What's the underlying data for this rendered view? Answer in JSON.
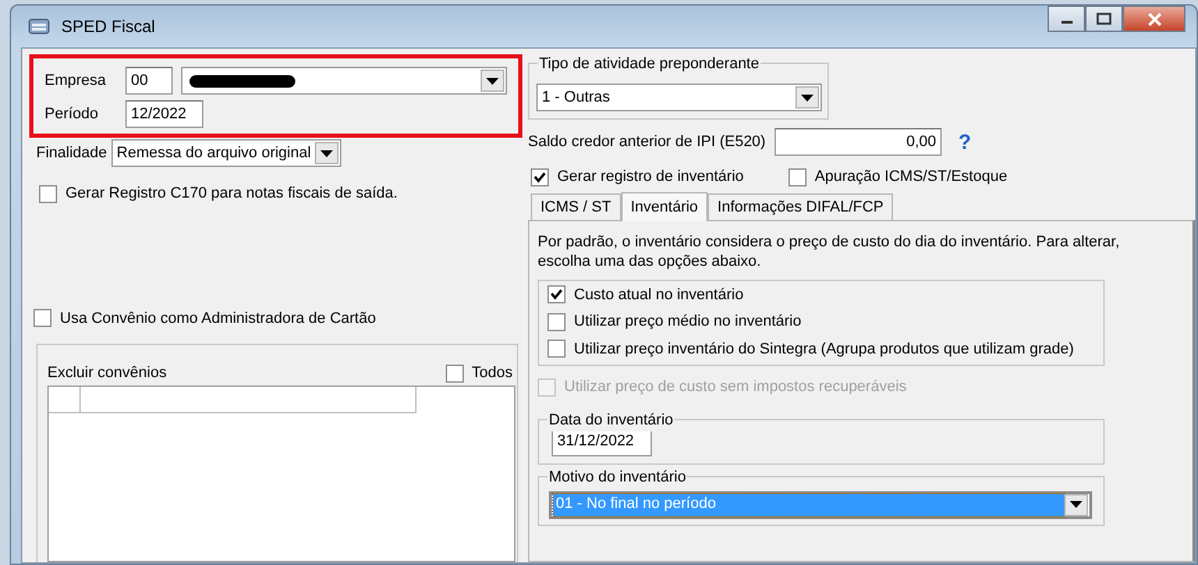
{
  "window": {
    "title": "SPED Fiscal"
  },
  "empresa": {
    "label": "Empresa",
    "code": "00"
  },
  "periodo": {
    "label": "Período",
    "value": "12/2022"
  },
  "finalidade": {
    "label": "Finalidade",
    "value": "Remessa do arquivo original"
  },
  "left_checks": [
    {
      "label": "Gerar Registro C170 para notas fiscais de saída.",
      "checked": false
    },
    {
      "label": "Usa Convênio como Administradora de Cartão",
      "checked": false
    }
  ],
  "excluir_convenios": {
    "label": "Excluir convênios",
    "todos": {
      "label": "Todos",
      "checked": false
    }
  },
  "tipo_atividade": {
    "legend": "Tipo de atividade preponderante",
    "value": "1 - Outras"
  },
  "saldo_ipi": {
    "label": "Saldo credor anterior de IPI (E520)",
    "value": "0,00",
    "help": "?"
  },
  "right_checks": [
    {
      "label": "Gerar registro de inventário",
      "checked": true
    },
    {
      "label": "Apuração ICMS/ST/Estoque",
      "checked": false
    }
  ],
  "tabs": [
    {
      "label": "ICMS / ST",
      "selected": false
    },
    {
      "label": "Inventário",
      "selected": true
    },
    {
      "label": "Informações DIFAL/FCP",
      "selected": false
    }
  ],
  "inventario": {
    "intro": "Por padrão, o inventário considera o preço de custo do dia do inventário. Para alterar, escolha uma das opções abaixo.",
    "options": [
      {
        "label": "Custo atual no inventário",
        "checked": true
      },
      {
        "label": "Utilizar preço médio no inventário",
        "checked": false
      },
      {
        "label": "Utilizar preço inventário do Sintegra (Agrupa produtos que utilizam grade)",
        "checked": false
      }
    ],
    "sem_impostos": {
      "label": "Utilizar preço de custo sem impostos recuperáveis",
      "checked": false,
      "disabled": true
    },
    "data": {
      "legend": "Data do inventário",
      "value": "31/12/2022"
    },
    "motivo": {
      "legend": "Motivo do inventário",
      "value": "01 - No final no período",
      "focused": true
    }
  }
}
